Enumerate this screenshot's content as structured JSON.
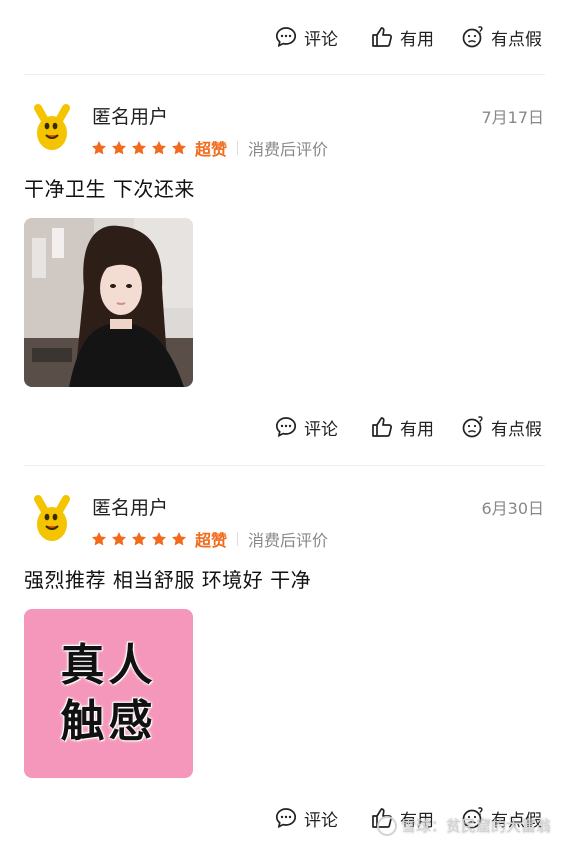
{
  "actions": {
    "comment_label": "评论",
    "useful_label": "有用",
    "fake_label": "有点假"
  },
  "reviews": [
    {
      "username": "匿名用户",
      "date": "7月17日",
      "rating": 5,
      "rating_label": "超赞",
      "verified_label": "消费后评价",
      "text": "干净卫生 下次还来"
    },
    {
      "username": "匿名用户",
      "date": "6月30日",
      "rating": 5,
      "rating_label": "超赞",
      "verified_label": "消费后评价",
      "text": "强烈推荐 相当舒服 环境好 干净",
      "image_text_line1": "真人",
      "image_text_line2": "触感"
    }
  ],
  "watermark": "雪球：贫民窟的大富翁",
  "colors": {
    "star": "#f26a1b",
    "accent": "#f26a1b",
    "muted": "#888888",
    "pink_image": "#f597ba"
  }
}
